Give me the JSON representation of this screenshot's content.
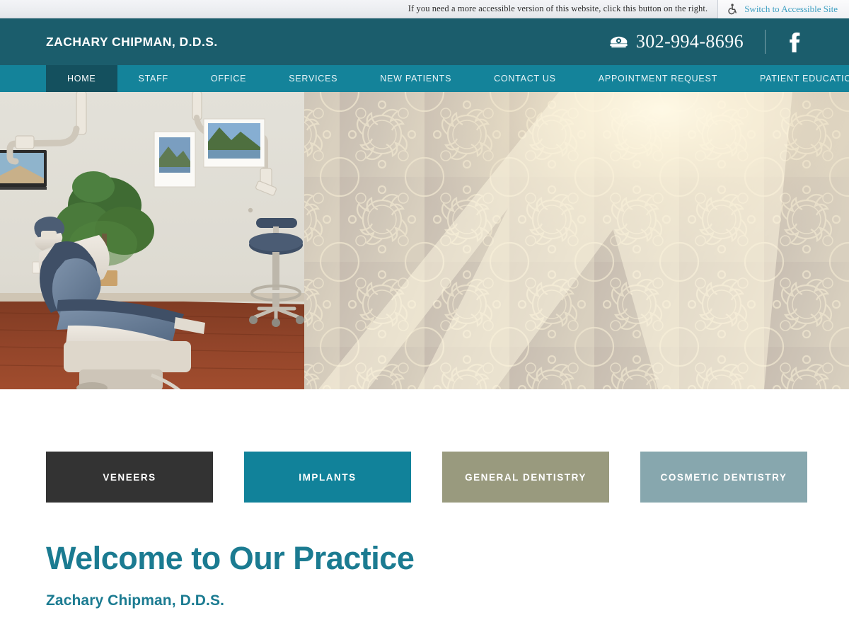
{
  "accessibility_bar": {
    "note": "If you need a more accessible version of this website, click this button on the right.",
    "button_label": "Switch to Accessible Site",
    "icon": "wheelchair-accessible-icon",
    "link_color": "#3fa0c2",
    "background": "#eceef1"
  },
  "header": {
    "brand": "ZACHARY CHIPMAN, D.D.S.",
    "phone": "302-994-8696",
    "phone_icon": "telephone-icon",
    "social": {
      "facebook_icon": "facebook-icon"
    },
    "background": "#1b5d6c"
  },
  "nav": {
    "background": "#14839a",
    "active_background": "#14505e",
    "items": [
      {
        "label": "HOME",
        "active": true
      },
      {
        "label": "STAFF",
        "active": false
      },
      {
        "label": "OFFICE",
        "active": false
      },
      {
        "label": "SERVICES",
        "active": false
      },
      {
        "label": "NEW PATIENTS",
        "active": false
      },
      {
        "label": "CONTACT US",
        "active": false
      },
      {
        "label": "APPOINTMENT REQUEST",
        "active": false
      },
      {
        "label": "PATIENT EDUCATION",
        "active": false
      }
    ]
  },
  "hero": {
    "alt": "Dental operatory with patient chair, wall-mounted monitor, framed landscape photographs, potted ficus tree, dentist stool and hardwood floor; right half shows damask-patterned wall with sun flare"
  },
  "services": {
    "buttons": [
      {
        "label": "VENEERS",
        "color": "#333333"
      },
      {
        "label": "IMPLANTS",
        "color": "#11829a"
      },
      {
        "label": "GENERAL DENTISTRY",
        "color": "#999a7e"
      },
      {
        "label": "COSMETIC DENTISTRY",
        "color": "#87a7ae"
      }
    ]
  },
  "welcome": {
    "heading": "Welcome to Our Practice",
    "subheading": "Zachary Chipman, D.D.S.",
    "accent_color": "#1b7b91"
  }
}
